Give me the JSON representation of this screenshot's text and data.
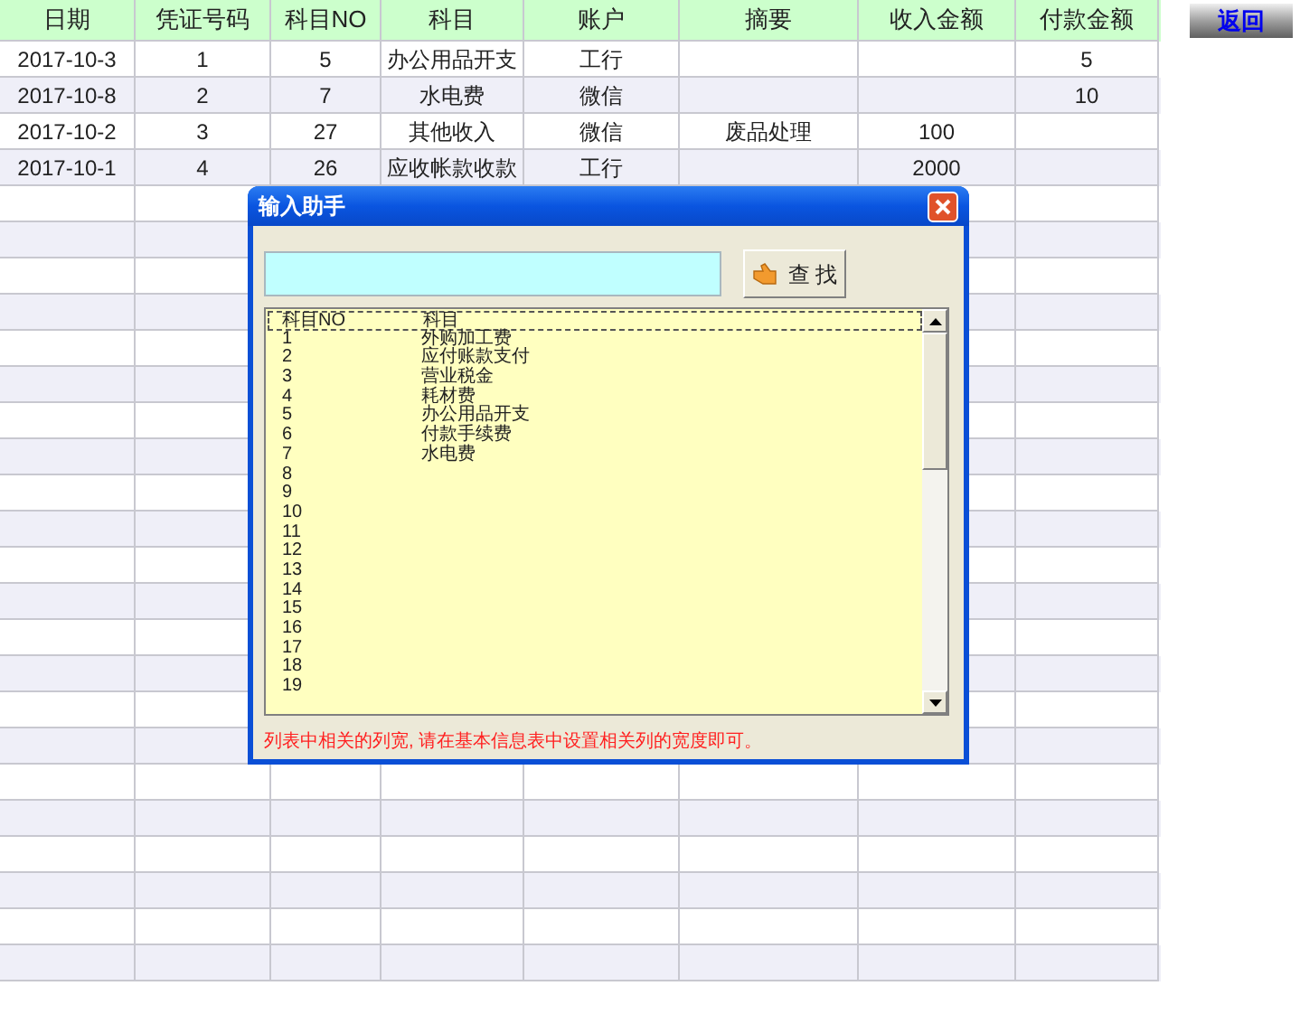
{
  "table": {
    "columns": [
      "日期",
      "凭证号码",
      "科目NO",
      "科目",
      "账户",
      "摘要",
      "收入金额",
      "付款金额"
    ],
    "rows": [
      [
        "2017-10-3",
        "1",
        "5",
        "办公用品开支",
        "工行",
        "",
        "",
        "5"
      ],
      [
        "2017-10-8",
        "2",
        "7",
        "水电费",
        "微信",
        "",
        "",
        "10"
      ],
      [
        "2017-10-2",
        "3",
        "27",
        "其他收入",
        "微信",
        "废品处理",
        "100",
        ""
      ],
      [
        "2017-10-1",
        "4",
        "26",
        "应收帐款收款",
        "工行",
        "",
        "2000",
        ""
      ]
    ]
  },
  "return_button": "返回",
  "dialog": {
    "title": "输入助手",
    "search_button": "查 找",
    "list": {
      "columns": [
        "科目NO",
        "科目"
      ],
      "items": [
        [
          "1",
          "外购加工费"
        ],
        [
          "2",
          "应付账款支付"
        ],
        [
          "3",
          "营业税金"
        ],
        [
          "4",
          "耗材费"
        ],
        [
          "5",
          "办公用品开支"
        ],
        [
          "6",
          "付款手续费"
        ],
        [
          "7",
          "水电费"
        ],
        [
          "8"
        ],
        [
          "9"
        ],
        [
          "10"
        ],
        [
          "11"
        ],
        [
          "12"
        ],
        [
          "13"
        ],
        [
          "14"
        ],
        [
          "15"
        ],
        [
          "16"
        ],
        [
          "17"
        ],
        [
          "18"
        ],
        [
          "19"
        ]
      ]
    },
    "message": "列表中相关的列宽, 请在基本信息表中设置相关列的宽度即可。"
  }
}
